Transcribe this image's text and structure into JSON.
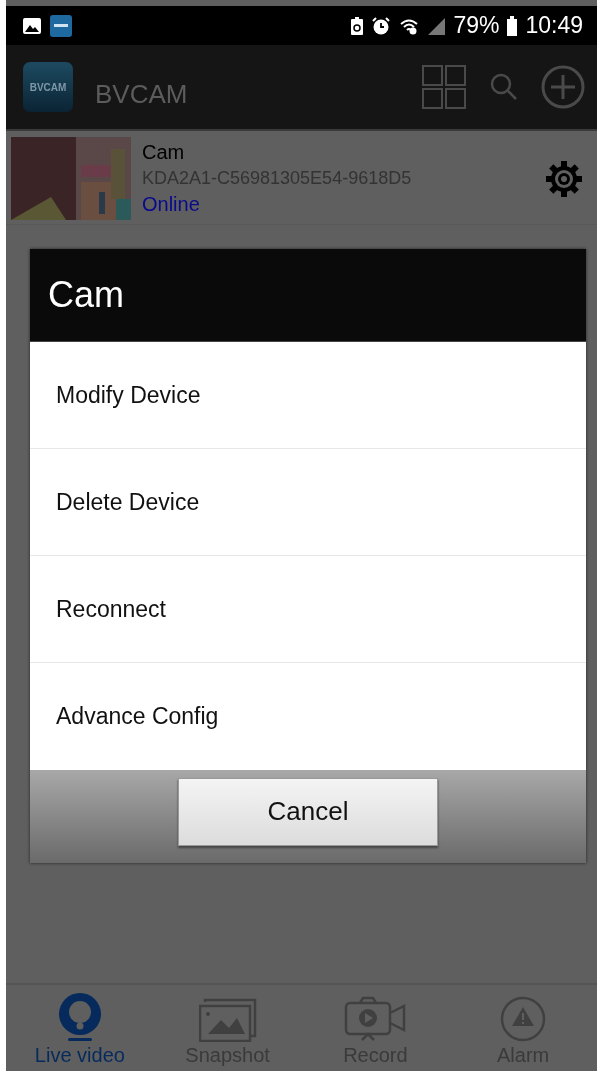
{
  "status_bar": {
    "battery": "79%",
    "time": "10:49"
  },
  "app_bar": {
    "logo_text": "BVCAM",
    "title": "BVCAM"
  },
  "devices": [
    {
      "name": "Cam",
      "uid": "KDA2A1-C56981305E54-9618D5",
      "status": "Online",
      "color": "#0a0a8c"
    }
  ],
  "dialog": {
    "title": "Cam",
    "items": [
      "Modify Device",
      "Delete Device",
      "Reconnect",
      "Advance Config"
    ],
    "cancel": "Cancel"
  },
  "tabs": [
    {
      "label": "Live video",
      "kind": "live",
      "selected": true
    },
    {
      "label": "Snapshot",
      "kind": "snapshot",
      "selected": false
    },
    {
      "label": "Record",
      "kind": "record",
      "selected": false
    },
    {
      "label": "Alarm",
      "kind": "alarm",
      "selected": false
    }
  ]
}
